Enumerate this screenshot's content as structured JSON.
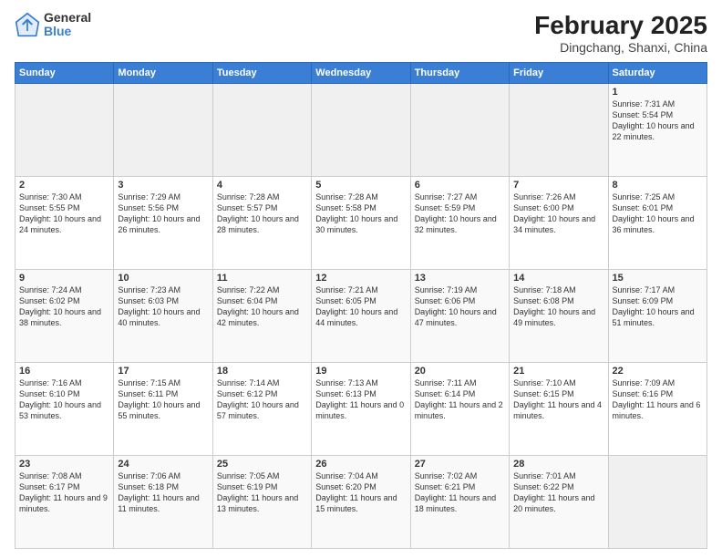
{
  "header": {
    "logo_general": "General",
    "logo_blue": "Blue",
    "title": "February 2025",
    "subtitle": "Dingchang, Shanxi, China"
  },
  "weekdays": [
    "Sunday",
    "Monday",
    "Tuesday",
    "Wednesday",
    "Thursday",
    "Friday",
    "Saturday"
  ],
  "weeks": [
    [
      {
        "day": "",
        "info": ""
      },
      {
        "day": "",
        "info": ""
      },
      {
        "day": "",
        "info": ""
      },
      {
        "day": "",
        "info": ""
      },
      {
        "day": "",
        "info": ""
      },
      {
        "day": "",
        "info": ""
      },
      {
        "day": "1",
        "info": "Sunrise: 7:31 AM\nSunset: 5:54 PM\nDaylight: 10 hours and 22 minutes."
      }
    ],
    [
      {
        "day": "2",
        "info": "Sunrise: 7:30 AM\nSunset: 5:55 PM\nDaylight: 10 hours and 24 minutes."
      },
      {
        "day": "3",
        "info": "Sunrise: 7:29 AM\nSunset: 5:56 PM\nDaylight: 10 hours and 26 minutes."
      },
      {
        "day": "4",
        "info": "Sunrise: 7:28 AM\nSunset: 5:57 PM\nDaylight: 10 hours and 28 minutes."
      },
      {
        "day": "5",
        "info": "Sunrise: 7:28 AM\nSunset: 5:58 PM\nDaylight: 10 hours and 30 minutes."
      },
      {
        "day": "6",
        "info": "Sunrise: 7:27 AM\nSunset: 5:59 PM\nDaylight: 10 hours and 32 minutes."
      },
      {
        "day": "7",
        "info": "Sunrise: 7:26 AM\nSunset: 6:00 PM\nDaylight: 10 hours and 34 minutes."
      },
      {
        "day": "8",
        "info": "Sunrise: 7:25 AM\nSunset: 6:01 PM\nDaylight: 10 hours and 36 minutes."
      }
    ],
    [
      {
        "day": "9",
        "info": "Sunrise: 7:24 AM\nSunset: 6:02 PM\nDaylight: 10 hours and 38 minutes."
      },
      {
        "day": "10",
        "info": "Sunrise: 7:23 AM\nSunset: 6:03 PM\nDaylight: 10 hours and 40 minutes."
      },
      {
        "day": "11",
        "info": "Sunrise: 7:22 AM\nSunset: 6:04 PM\nDaylight: 10 hours and 42 minutes."
      },
      {
        "day": "12",
        "info": "Sunrise: 7:21 AM\nSunset: 6:05 PM\nDaylight: 10 hours and 44 minutes."
      },
      {
        "day": "13",
        "info": "Sunrise: 7:19 AM\nSunset: 6:06 PM\nDaylight: 10 hours and 47 minutes."
      },
      {
        "day": "14",
        "info": "Sunrise: 7:18 AM\nSunset: 6:08 PM\nDaylight: 10 hours and 49 minutes."
      },
      {
        "day": "15",
        "info": "Sunrise: 7:17 AM\nSunset: 6:09 PM\nDaylight: 10 hours and 51 minutes."
      }
    ],
    [
      {
        "day": "16",
        "info": "Sunrise: 7:16 AM\nSunset: 6:10 PM\nDaylight: 10 hours and 53 minutes."
      },
      {
        "day": "17",
        "info": "Sunrise: 7:15 AM\nSunset: 6:11 PM\nDaylight: 10 hours and 55 minutes."
      },
      {
        "day": "18",
        "info": "Sunrise: 7:14 AM\nSunset: 6:12 PM\nDaylight: 10 hours and 57 minutes."
      },
      {
        "day": "19",
        "info": "Sunrise: 7:13 AM\nSunset: 6:13 PM\nDaylight: 11 hours and 0 minutes."
      },
      {
        "day": "20",
        "info": "Sunrise: 7:11 AM\nSunset: 6:14 PM\nDaylight: 11 hours and 2 minutes."
      },
      {
        "day": "21",
        "info": "Sunrise: 7:10 AM\nSunset: 6:15 PM\nDaylight: 11 hours and 4 minutes."
      },
      {
        "day": "22",
        "info": "Sunrise: 7:09 AM\nSunset: 6:16 PM\nDaylight: 11 hours and 6 minutes."
      }
    ],
    [
      {
        "day": "23",
        "info": "Sunrise: 7:08 AM\nSunset: 6:17 PM\nDaylight: 11 hours and 9 minutes."
      },
      {
        "day": "24",
        "info": "Sunrise: 7:06 AM\nSunset: 6:18 PM\nDaylight: 11 hours and 11 minutes."
      },
      {
        "day": "25",
        "info": "Sunrise: 7:05 AM\nSunset: 6:19 PM\nDaylight: 11 hours and 13 minutes."
      },
      {
        "day": "26",
        "info": "Sunrise: 7:04 AM\nSunset: 6:20 PM\nDaylight: 11 hours and 15 minutes."
      },
      {
        "day": "27",
        "info": "Sunrise: 7:02 AM\nSunset: 6:21 PM\nDaylight: 11 hours and 18 minutes."
      },
      {
        "day": "28",
        "info": "Sunrise: 7:01 AM\nSunset: 6:22 PM\nDaylight: 11 hours and 20 minutes."
      },
      {
        "day": "",
        "info": ""
      }
    ]
  ]
}
